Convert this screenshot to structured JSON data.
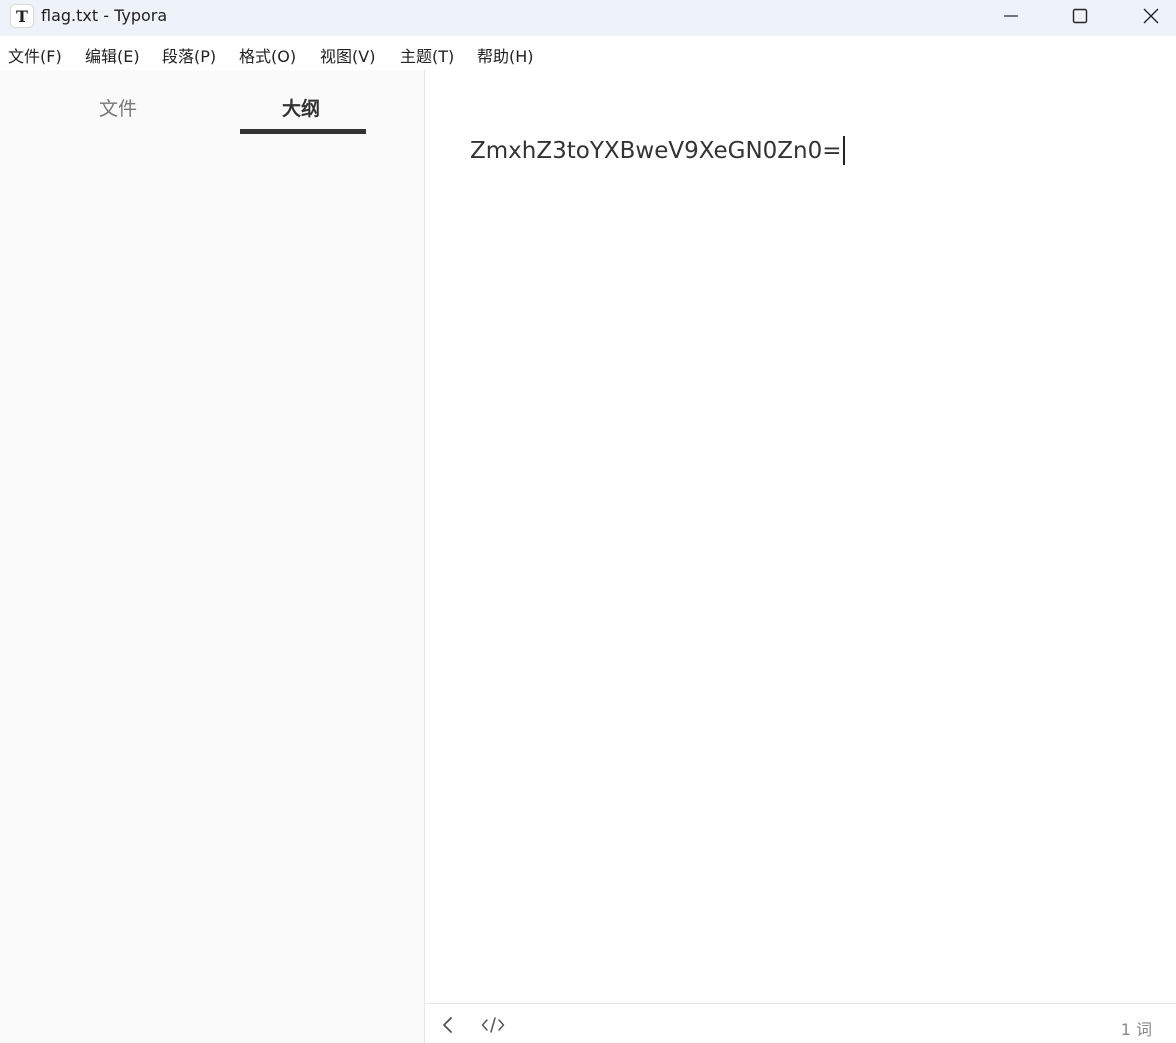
{
  "window": {
    "app_icon_glyph": "T",
    "title": "flag.txt - Typora"
  },
  "menu": {
    "items": [
      "文件(F)",
      "编辑(E)",
      "段落(P)",
      "格式(O)",
      "视图(V)",
      "主题(T)",
      "帮助(H)"
    ]
  },
  "sidebar": {
    "tabs": {
      "files": "文件",
      "outline": "大纲"
    },
    "active_tab": "outline"
  },
  "editor": {
    "content": "ZmxhZ3toYXBweV9XeGN0Zn0="
  },
  "statusbar": {
    "word_count": "1 词"
  },
  "icons": {
    "back": "chevron-left-icon",
    "source": "code-icon",
    "minimize": "minimize-icon",
    "maximize": "maximize-icon",
    "close": "close-icon"
  }
}
